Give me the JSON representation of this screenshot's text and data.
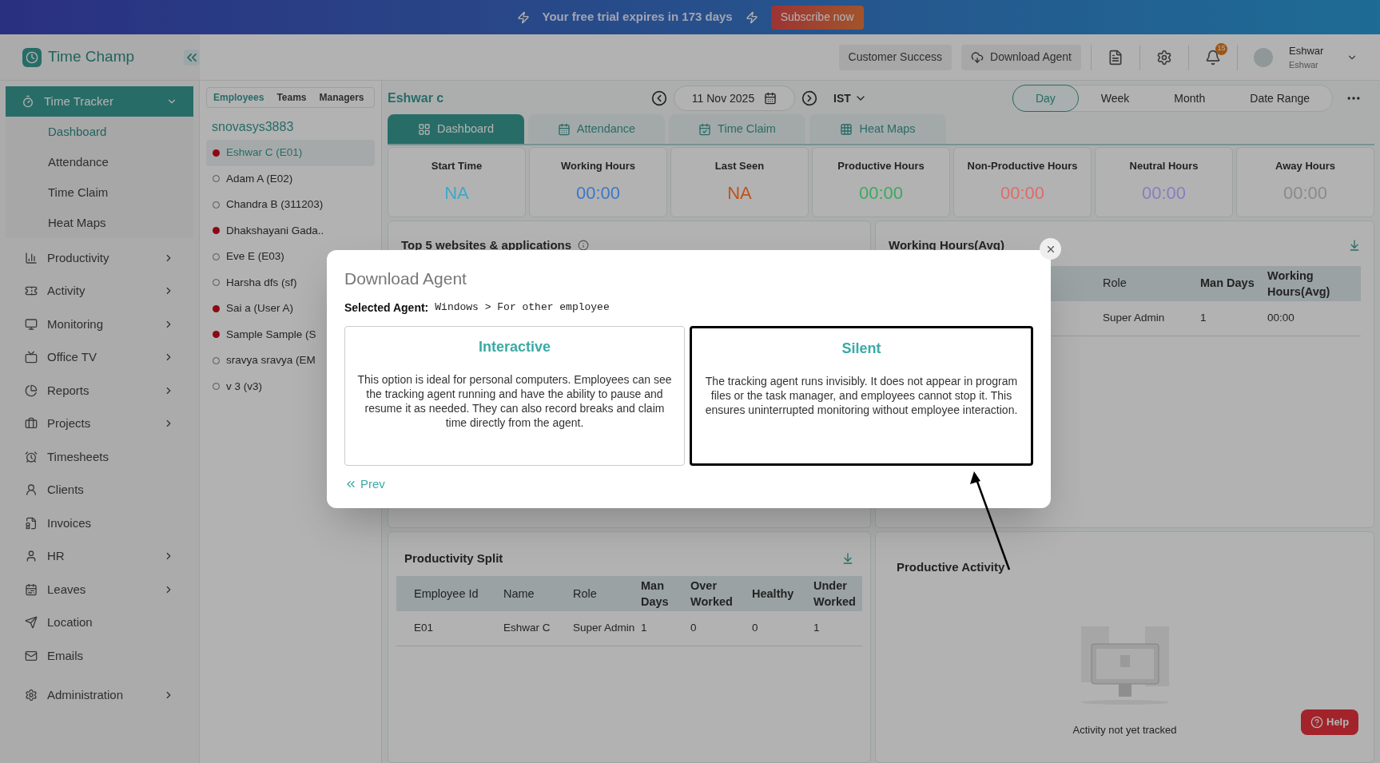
{
  "banner": {
    "message": "Your free trial expires in 173 days",
    "button": "Subscribe now"
  },
  "header": {
    "logo": "Time Champ",
    "buttons": [
      "Customer Success",
      "Download Agent"
    ],
    "notification_count": "15",
    "user": {
      "name": "Eshwar",
      "subtitle": "Eshwar"
    }
  },
  "sidebar": {
    "items": [
      {
        "label": "Time Tracker",
        "expanded": true,
        "children": [
          {
            "label": "Dashboard",
            "selected": true
          },
          {
            "label": "Attendance",
            "selected": false
          },
          {
            "label": "Time Claim",
            "selected": false
          },
          {
            "label": "Heat Maps",
            "selected": false
          }
        ]
      },
      {
        "label": "Productivity",
        "expanded": false,
        "has_arrow": true
      },
      {
        "label": "Activity",
        "expanded": false,
        "has_arrow": true
      },
      {
        "label": "Monitoring",
        "expanded": false,
        "has_arrow": true
      },
      {
        "label": "Office TV",
        "expanded": false,
        "has_arrow": true
      },
      {
        "label": "Reports",
        "expanded": false,
        "has_arrow": true
      },
      {
        "label": "Projects",
        "expanded": false,
        "has_arrow": true
      },
      {
        "label": "Timesheets",
        "expanded": false,
        "has_arrow": false
      },
      {
        "label": "Clients",
        "expanded": false,
        "has_arrow": false
      },
      {
        "label": "Invoices",
        "expanded": false,
        "has_arrow": false
      },
      {
        "label": "HR",
        "expanded": false,
        "has_arrow": true
      },
      {
        "label": "Leaves",
        "expanded": false,
        "has_arrow": true
      },
      {
        "label": "Location",
        "expanded": false,
        "has_arrow": false
      },
      {
        "label": "Emails",
        "expanded": false,
        "has_arrow": false
      },
      {
        "label": "Administration",
        "expanded": false,
        "has_arrow": true
      }
    ]
  },
  "employee_panel": {
    "tabs": [
      {
        "label": "Employees",
        "selected": true
      },
      {
        "label": "Teams",
        "selected": false
      },
      {
        "label": "Managers",
        "selected": false
      }
    ],
    "organization": "snovasys3883",
    "employees": [
      {
        "name": "Eshwar C (E01)",
        "online": true,
        "selected": true
      },
      {
        "name": "Adam A (E02)",
        "online": false,
        "selected": false
      },
      {
        "name": "Chandra B (311203)",
        "online": false,
        "selected": false
      },
      {
        "name": "Dhakshayani Gada..",
        "online": true,
        "selected": false
      },
      {
        "name": "Eve E (E03)",
        "online": false,
        "selected": false
      },
      {
        "name": "Harsha dfs (sf)",
        "online": false,
        "selected": false
      },
      {
        "name": "Sai a (User A)",
        "online": true,
        "selected": false
      },
      {
        "name": "Sample Sample (S",
        "online": true,
        "selected": false
      },
      {
        "name": "sravya sravya (EM",
        "online": false,
        "selected": false
      },
      {
        "name": "v 3 (v3)",
        "online": false,
        "selected": false
      }
    ]
  },
  "toolbar": {
    "title": "Eshwar c",
    "date": "11 Nov 2025",
    "timezone": "IST",
    "ranges": [
      {
        "label": "Day",
        "selected": true
      },
      {
        "label": "Week",
        "selected": false
      },
      {
        "label": "Month",
        "selected": false
      },
      {
        "label": "Date Range",
        "selected": false
      }
    ]
  },
  "view_tabs": [
    {
      "label": "Dashboard",
      "selected": true
    },
    {
      "label": "Attendance",
      "selected": false
    },
    {
      "label": "Time Claim",
      "selected": false
    },
    {
      "label": "Heat Maps",
      "selected": false
    }
  ],
  "stats": [
    {
      "label": "Start Time",
      "value": "NA",
      "color": "#3ea8c8"
    },
    {
      "label": "Working Hours",
      "value": "00:00",
      "color": "#3a78c9"
    },
    {
      "label": "Last Seen",
      "value": "NA",
      "color": "#c0521e"
    },
    {
      "label": "Productive Hours",
      "value": "00:00",
      "color": "#3aaa5e"
    },
    {
      "label": "Non-Productive Hours",
      "value": "00:00",
      "color": "#e06a6a"
    },
    {
      "label": "Neutral Hours",
      "value": "00:00",
      "color": "#8a7cc0"
    },
    {
      "label": "Away Hours",
      "value": "00:00",
      "color": "#8a8a8a"
    }
  ],
  "top_websites": {
    "title": "Top 5 websites & applications"
  },
  "working_hours": {
    "title": "Working Hours(Avg)",
    "columns": [
      "Role",
      "Man Days",
      "Working Hours(Avg)"
    ],
    "rows": [
      [
        "Super Admin",
        "1",
        "00:00"
      ]
    ]
  },
  "productivity_split": {
    "title": "Productivity Split",
    "columns": [
      "Employee Id",
      "Name",
      "Role",
      "Man Days",
      "Over Worked",
      "Healthy",
      "Under Worked"
    ],
    "rows": [
      [
        "E01",
        "Eshwar C",
        "Super Admin",
        "1",
        "0",
        "0",
        "1"
      ]
    ]
  },
  "productive_activity": {
    "title": "Productive Activity",
    "empty_message": "Activity not yet tracked"
  },
  "help": "Help",
  "modal": {
    "title": "Download Agent",
    "selected_label": "Selected Agent:",
    "selected_value": "Windows > For other employee",
    "options": [
      {
        "title": "Interactive",
        "description": "This option is ideal for personal computers. Employees can see the tracking agent running and have the ability to pause and resume it as needed. They can also record breaks and claim time directly from the agent.",
        "selected": false
      },
      {
        "title": "Silent",
        "description": "The tracking agent runs invisibly. It does not appear in program files or the task manager, and employees cannot stop it. This ensures uninterrupted monitoring without employee interaction.",
        "selected": true
      }
    ],
    "back": "Prev"
  }
}
